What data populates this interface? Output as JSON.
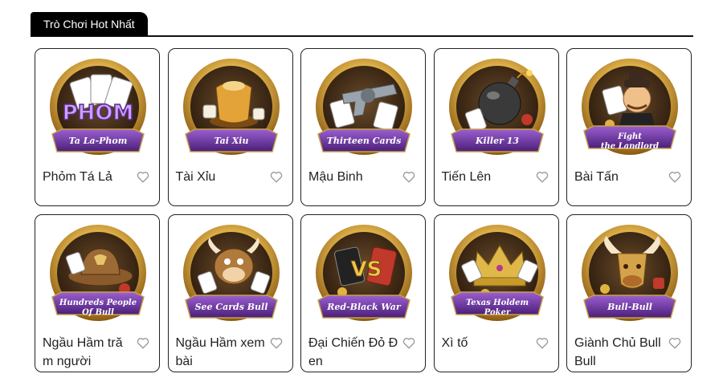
{
  "section": {
    "title": "Trò Chơi Hot Nhất"
  },
  "games": [
    {
      "title": "Phỏm Tá Lả",
      "emblem_label": [
        "Ta La-Phom"
      ],
      "icon": "phom-cards-icon",
      "accent": "#c9a3ff"
    },
    {
      "title": "Tài Xỉu",
      "emblem_label": [
        "Tai Xiu"
      ],
      "icon": "dice-cup-icon",
      "accent": "#e4a338"
    },
    {
      "title": "Mậu Binh",
      "emblem_label": [
        "Thirteen Cards"
      ],
      "icon": "revolver-cards-icon",
      "accent": "#9aa4ad"
    },
    {
      "title": "Tiến Lên",
      "emblem_label": [
        "Killer 13"
      ],
      "icon": "bomb-icon",
      "accent": "#3a3a3a"
    },
    {
      "title": "Bài Tấn",
      "emblem_label": [
        "Fight",
        "the Landlord"
      ],
      "icon": "landlord-icon",
      "accent": "#f0c08a"
    },
    {
      "title": "Ngầu Hầm trăm người",
      "emblem_label": [
        "Hundreds People",
        "Of Bull"
      ],
      "icon": "cowboy-hat-icon",
      "accent": "#8a5a2b"
    },
    {
      "title": "Ngầu Hầm xem bài",
      "emblem_label": [
        "See Cards Bull"
      ],
      "icon": "bull-mascot-icon",
      "accent": "#b07a3c"
    },
    {
      "title": "Đại Chiến Đỏ Đen",
      "emblem_label": [
        "Red-Black War"
      ],
      "icon": "vs-cards-icon",
      "accent": "#c0392b"
    },
    {
      "title": "Xì tố",
      "emblem_label": [
        "Texas Holdem",
        "Poker"
      ],
      "icon": "crown-icon",
      "accent": "#e0b84a"
    },
    {
      "title": "Giành Chủ Bull Bull",
      "emblem_label": [
        "Bull-Bull"
      ],
      "icon": "bull-head-icon",
      "accent": "#d4a24a"
    }
  ]
}
